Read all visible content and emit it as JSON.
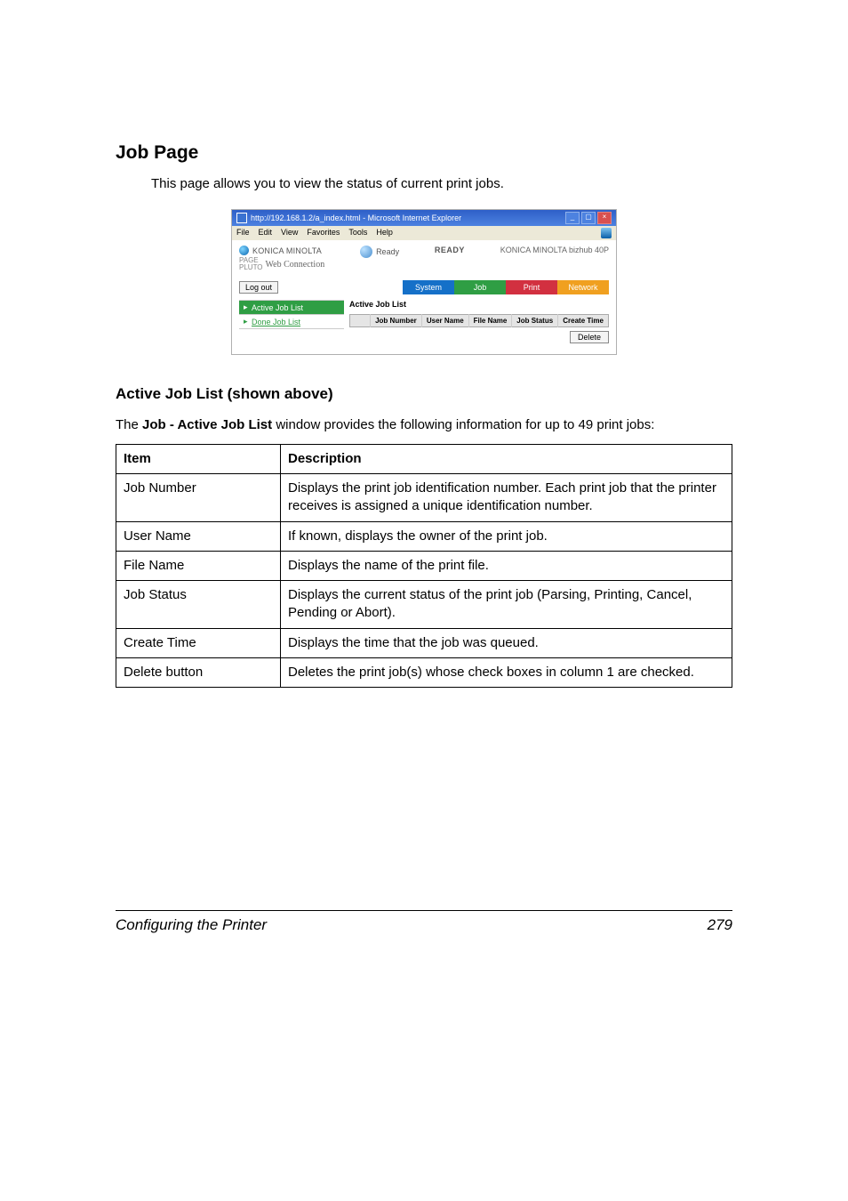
{
  "section_title": "Job Page",
  "intro": "This page allows you to view the status of current print jobs.",
  "screenshot": {
    "ie_title": "http://192.168.1.2/a_index.html - Microsoft Internet Explorer",
    "menu": {
      "file": "File",
      "edit": "Edit",
      "view": "View",
      "favorites": "Favorites",
      "tools": "Tools",
      "help": "Help"
    },
    "brand": {
      "name": "KONICA MINOLTA",
      "pluto": "PAGE\nPLUTO",
      "wc": "Web Connection"
    },
    "ready_label": "Ready",
    "ready_center": "READY",
    "model": "KONICA MINOLTA bizhub 40P",
    "logout": "Log out",
    "tabs": {
      "system": "System",
      "job": "Job",
      "print": "Print",
      "network": "Network"
    },
    "side": {
      "active": "Active Job List",
      "done": "Done Job List",
      "arrow": "▸"
    },
    "panel_title": "Active Job List",
    "columns": {
      "c0": "",
      "c1": "Job Number",
      "c2": "User Name",
      "c3": "File Name",
      "c4": "Job Status",
      "c5": "Create Time"
    },
    "delete": "Delete"
  },
  "sub_title": "Active Job List (shown above)",
  "desc_prefix": "The ",
  "desc_bold": "Job - Active Job List",
  "desc_suffix": " window provides the following information for up to 49 print jobs:",
  "table": {
    "h1": "Item",
    "h2": "Description",
    "rows": [
      {
        "item": "Job Number",
        "desc": "Displays the print job identification number. Each print job that the printer receives is assigned a unique identification number."
      },
      {
        "item": "User Name",
        "desc": "If known, displays the owner of the print job."
      },
      {
        "item": "File Name",
        "desc": "Displays the name of the print file."
      },
      {
        "item": "Job Status",
        "desc": "Displays the current status of the print job (Parsing, Printing, Cancel, Pending or Abort)."
      },
      {
        "item": "Create Time",
        "desc": "Displays the time that the job was queued."
      },
      {
        "item": "Delete button",
        "desc": "Deletes the print job(s) whose check boxes in column 1 are checked."
      }
    ]
  },
  "footer_left": "Configuring the Printer",
  "footer_right": "279"
}
